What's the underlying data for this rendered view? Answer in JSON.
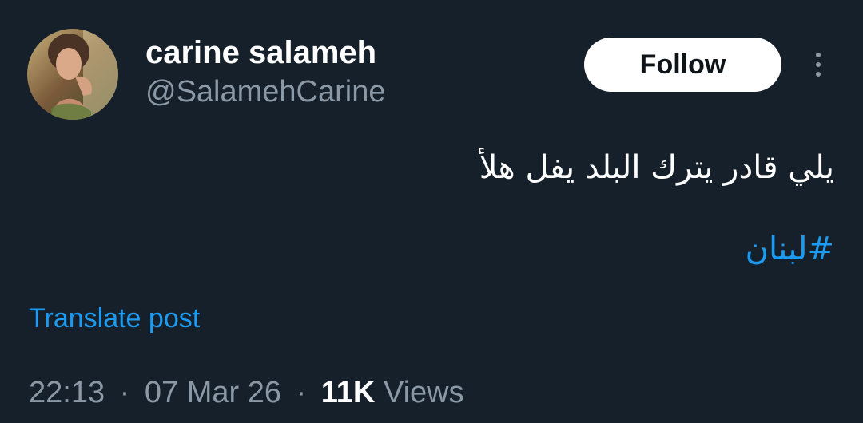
{
  "author": {
    "name": "carine salameh",
    "handle": "@SalamehCarine",
    "avatar_icon": "profile-photo"
  },
  "actions": {
    "follow_label": "Follow",
    "more_icon": "more-vertical-icon"
  },
  "tweet": {
    "text": "يلي قادر يترك البلد يفل هلأ",
    "hashtag": "#لبنان",
    "translate_label": "Translate post"
  },
  "meta": {
    "time": "22:13",
    "separator": "·",
    "date": "07 Mar 26",
    "views_count": "11K",
    "views_label": "Views"
  },
  "colors": {
    "background": "#15202b",
    "link": "#1d9bf0",
    "muted": "#8b98a5",
    "text": "#ffffff"
  }
}
